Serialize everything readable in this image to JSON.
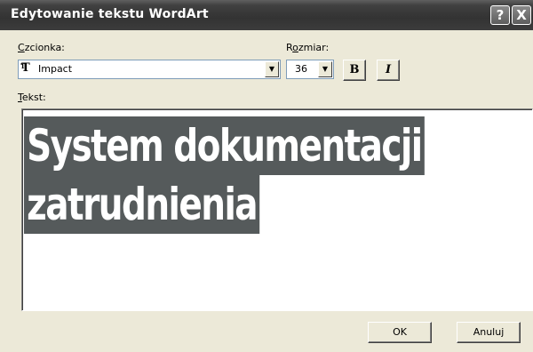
{
  "window": {
    "title": "Edytowanie tekstu WordArt",
    "help_glyph": "?",
    "close_glyph": "X"
  },
  "font": {
    "label_first": "C",
    "label_rest": "zcionka:",
    "value": "Impact",
    "icon_main": "T",
    "icon_sup": "T"
  },
  "size": {
    "label_first": "R",
    "label_middle": "o",
    "label_rest": "zmiar:",
    "value": "36"
  },
  "format": {
    "bold_label": "B",
    "italic_label": "I"
  },
  "text": {
    "label_first": "T",
    "label_rest": "ekst:",
    "line1": "System dokumentacji",
    "line2": "zatrudnienia"
  },
  "buttons": {
    "ok_label": "OK",
    "cancel_label": "Anuluj"
  },
  "icons": {
    "dropdown": "chevron-down-icon",
    "font_type": "truetype-font-icon",
    "help": "help-icon",
    "close": "close-icon"
  },
  "colors": {
    "titlebar": "#3a3a3a",
    "dialog_bg": "#ece9d8",
    "selection_bg": "#555a5b"
  }
}
